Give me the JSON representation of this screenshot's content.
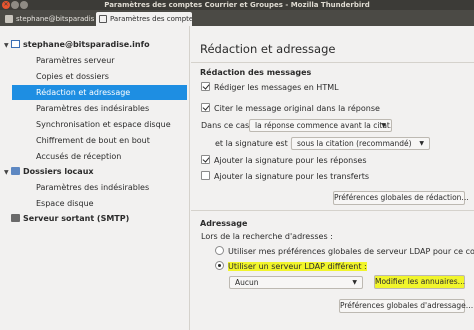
{
  "window": {
    "title": "Paramètres des comptes Courrier et Groupes - Mozilla Thunderbird"
  },
  "tabs": [
    {
      "label": "stephane@bitsparadise.info"
    },
    {
      "label": "Paramètres des comptes"
    }
  ],
  "sidebar": {
    "account": "stephane@bitsparadise.info",
    "account_items": [
      "Paramètres serveur",
      "Copies et dossiers",
      "Rédaction et adressage",
      "Paramètres des indésirables",
      "Synchronisation et espace disque",
      "Chiffrement de bout en bout",
      "Accusés de réception"
    ],
    "local_folders": "Dossiers locaux",
    "local_items": [
      "Paramètres des indésirables",
      "Espace disque"
    ],
    "smtp": "Serveur sortant (SMTP)",
    "selected_index": 2
  },
  "main": {
    "title": "Rédaction et adressage",
    "composition": {
      "heading": "Rédaction des messages",
      "html_label": "Rédiger les messages en HTML",
      "html_checked": true,
      "quote_label": "Citer le message original dans la réponse",
      "quote_checked": true,
      "case_label": "Dans ce cas,",
      "case_value": "la réponse commence avant la citat…",
      "sig_label": "et la signature est placée",
      "sig_value": "sous la citation (recommandé)",
      "sig_replies_label": "Ajouter la signature pour les réponses",
      "sig_replies_checked": true,
      "sig_forwards_label": "Ajouter la signature pour les transferts",
      "sig_forwards_checked": false,
      "prefs_button": "Préférences globales de rédaction…"
    },
    "addressing": {
      "heading": "Adressage",
      "lookup_label": "Lors de la recherche d'adresses :",
      "global_ldap_label": "Utiliser mes préférences globales de serveur LDAP pour ce compte",
      "different_ldap_label": "Utiliser un serveur LDAP différent :",
      "selected_option": "different",
      "ldap_value": "Aucun",
      "edit_dirs_button": "Modifier les annuaires…",
      "prefs_button": "Préférences globales d'adressage…"
    }
  },
  "colors": {
    "selection": "#1e8ee2",
    "highlight": "#f1f52b",
    "titlebar": "#3c3b37"
  },
  "icons": {
    "close": "close-icon",
    "minimize": "minimize-icon",
    "maximize": "maximize-icon",
    "mail_account": "mail-account-icon",
    "folder": "folder-icon",
    "server": "server-icon"
  }
}
